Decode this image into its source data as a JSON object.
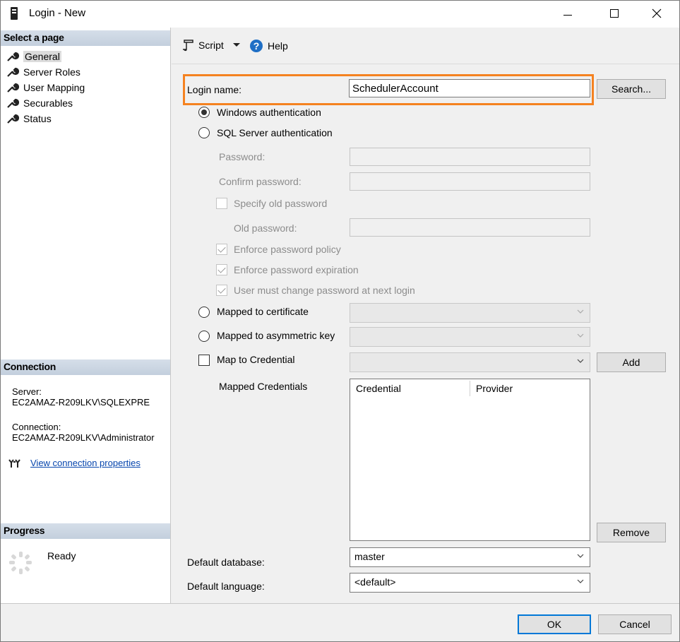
{
  "window": {
    "title": "Login - New"
  },
  "select_page": {
    "header": "Select a page",
    "items": [
      {
        "label": "General",
        "selected": true
      },
      {
        "label": "Server Roles",
        "selected": false
      },
      {
        "label": "User Mapping",
        "selected": false
      },
      {
        "label": "Securables",
        "selected": false
      },
      {
        "label": "Status",
        "selected": false
      }
    ]
  },
  "connection": {
    "header": "Connection",
    "server_label": "Server:",
    "server_value": "EC2AMAZ-R209LKV\\SQLEXPRE",
    "connection_label": "Connection:",
    "connection_value": "EC2AMAZ-R209LKV\\Administrator",
    "link": "View connection properties"
  },
  "progress": {
    "header": "Progress",
    "status": "Ready"
  },
  "toolbar": {
    "script": "Script",
    "help": "Help"
  },
  "form": {
    "login_name_label": "Login name:",
    "login_name_value": "SchedulerAccount",
    "search_button": "Search...",
    "windows_auth": "Windows authentication",
    "sql_auth": "SQL Server authentication",
    "password_label": "Password:",
    "confirm_password_label": "Confirm password:",
    "specify_old_password": "Specify old password",
    "old_password_label": "Old password:",
    "enforce_policy": "Enforce password policy",
    "enforce_expiration": "Enforce password expiration",
    "must_change": "User must change password at next login",
    "mapped_cert": "Mapped to certificate",
    "mapped_asym": "Mapped to asymmetric key",
    "map_credential": "Map to Credential",
    "add_button": "Add",
    "mapped_credentials_label": "Mapped Credentials",
    "grid_columns": [
      "Credential",
      "Provider"
    ],
    "remove_button": "Remove",
    "default_database_label": "Default database:",
    "default_database_value": "master",
    "default_language_label": "Default language:",
    "default_language_value": "<default>"
  },
  "footer": {
    "ok": "OK",
    "cancel": "Cancel"
  },
  "colors": {
    "highlight": "#f58220",
    "link": "#0645ad",
    "section_header": "#c9d4e1"
  }
}
